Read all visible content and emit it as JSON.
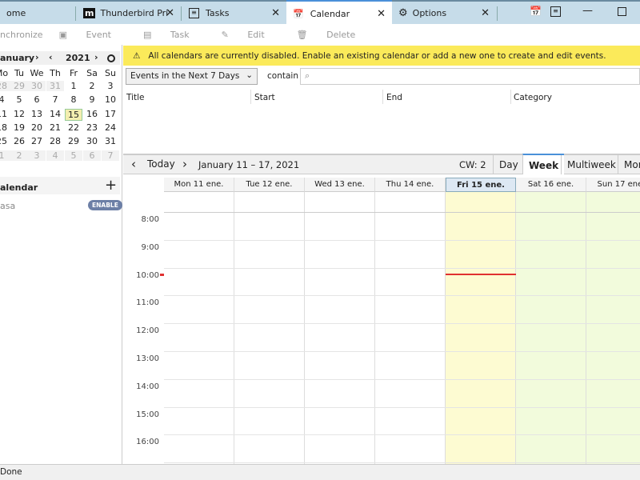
{
  "tabs": [
    {
      "label": "ome",
      "icon": "home-icon"
    },
    {
      "label": "Thunderbird Pri",
      "icon": "m-logo-icon"
    },
    {
      "label": "Tasks",
      "icon": "tasks-icon"
    },
    {
      "label": "Calendar",
      "icon": "calendar-icon",
      "selected": true
    },
    {
      "label": "Options",
      "icon": "gear-icon"
    }
  ],
  "toolbar": {
    "synchronize": "nchronize",
    "event": "Event",
    "task": "Task",
    "edit": "Edit",
    "delete": "Delete"
  },
  "minical": {
    "month": "anuary",
    "year": "2021",
    "daynames": [
      "Mo",
      "Tu",
      "We",
      "Th",
      "Fr",
      "Sa",
      "Su"
    ],
    "weeks": [
      [
        "28",
        "29",
        "30",
        "31",
        "1",
        "2",
        "3"
      ],
      [
        "4",
        "5",
        "6",
        "7",
        "8",
        "9",
        "10"
      ],
      [
        "11",
        "12",
        "13",
        "14",
        "15",
        "16",
        "17"
      ],
      [
        "18",
        "19",
        "20",
        "21",
        "22",
        "23",
        "24"
      ],
      [
        "25",
        "26",
        "27",
        "28",
        "29",
        "30",
        "31"
      ],
      [
        "1",
        "2",
        "3",
        "4",
        "5",
        "6",
        "7"
      ]
    ],
    "today": "15"
  },
  "calendars": {
    "header": "alendar",
    "items": [
      {
        "name": "asa",
        "action": "ENABLE"
      }
    ]
  },
  "notification": "All calendars are currently disabled. Enable an existing calendar or add a new one to create and edit events.",
  "filter": {
    "selected": "Events in the Next 7 Days",
    "contain_label": "contain",
    "search_value": ""
  },
  "list_headers": [
    "Title",
    "Start",
    "End",
    "Category"
  ],
  "nav": {
    "today": "Today",
    "range": "January 11 – 17, 2021",
    "cw": "CW: 2",
    "views": [
      "Day",
      "Week",
      "Multiweek",
      "Mon"
    ],
    "selected_view": "Week"
  },
  "days": [
    "Mon 11 ene.",
    "Tue 12 ene.",
    "Wed 13 ene.",
    "Thu 14 ene.",
    "Fri 15 ene.",
    "Sat 16 ene.",
    "Sun 17 ene."
  ],
  "hours": [
    "8:00",
    "9:00",
    "10:00",
    "11:00",
    "12:00",
    "13:00",
    "14:00",
    "15:00",
    "16:00"
  ],
  "colors": {
    "today": "#fdfbd2",
    "weekend": "#f2fbdc",
    "now_line": "#e03030",
    "notification": "#fbea5a"
  },
  "status": "Done"
}
